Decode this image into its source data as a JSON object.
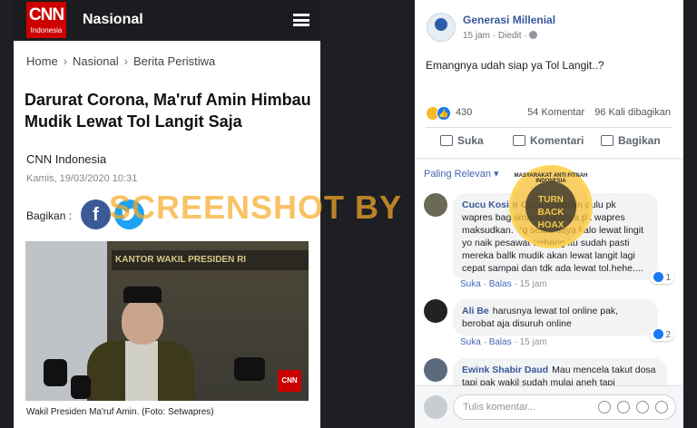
{
  "cnn": {
    "logo_main": "CNN",
    "logo_sub": "Indonesia",
    "section": "Nasional",
    "breadcrumb": [
      "Home",
      "Nasional",
      "Berita Peristiwa"
    ],
    "headline": "Darurat Corona, Ma'ruf Amin Himbau Mudik Lewat Tol Langit Saja",
    "source": "CNN Indonesia",
    "date": "Kamis, 19/03/2020 10:31",
    "share_label": "Bagikan :",
    "photo_sign": "KANTOR WAKIL PRESIDEN RI",
    "photo_badge": "CNN",
    "caption": "Wakil Presiden Ma'ruf Amin. (Foto: Setwapres)",
    "colors": {
      "brand": "#cc0000",
      "header": "#1b1c20",
      "facebook": "#3b5998",
      "twitter": "#1da1f2"
    }
  },
  "fb": {
    "page_name": "Generasi Millenial",
    "meta": "15 jam · Diedit ·",
    "post_text": "Emangnya udah siap ya Tol Langit..?",
    "reaction_count": "430",
    "comments_count": "54 Komentar",
    "shares_count": "96 Kali dibagikan",
    "actions": {
      "like": "Suka",
      "comment": "Komentari",
      "share": "Bagikan"
    },
    "sort_label": "Paling Relevan ▾",
    "comments": [
      {
        "author": "Cucu Kosim",
        "text": "Coba contohin dulu pk wapres bagaimana caranya pk wapres maksudkan. Yg setau saya kalo lewat lingit yo naik pesawat terbang itu sudah pasti mereka ballk mudik akan lewat langit lagi cepat sampai dan tdk ada lewat tol.hehe....",
        "like": "Suka",
        "reply": "Balas",
        "time": "15 jam",
        "reactions": "1"
      },
      {
        "author": "Ali Be",
        "text": "harusnya lewat tol online pak, berobat aja disuruh online",
        "like": "Suka",
        "reply": "Balas",
        "time": "15 jam",
        "reactions": "2"
      },
      {
        "author": "Ewink Shabir Daud",
        "text": "Mau mencela takut dosa tapi pak wakil sudah mulai aneh tapi"
      }
    ],
    "input_placeholder": "Tulis komentar...",
    "colors": {
      "link": "#385898",
      "accent": "#1877f2"
    }
  },
  "watermark": {
    "text": "SCREENSHOT BY",
    "badge_arc": "MASYARAKAT ANTI FITNAH INDONESIA",
    "badge_center": "TURN BACK HOAX"
  }
}
